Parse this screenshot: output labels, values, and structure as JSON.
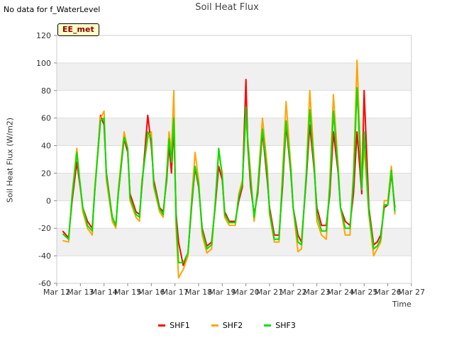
{
  "header": {
    "note": "No data for f_WaterLevel",
    "badge": "EE_met"
  },
  "chart_data": {
    "type": "line",
    "title": "Soil Heat Flux",
    "xlabel": "Time",
    "ylabel": "Soil Heat Flux (W/m2)",
    "ylim": [
      -60,
      120
    ],
    "xlim": [
      0,
      15
    ],
    "yticks": [
      -60,
      -40,
      -20,
      0,
      20,
      40,
      60,
      80,
      100,
      120
    ],
    "xticks": [
      "Mar 12",
      "Mar 13",
      "Mar 14",
      "Mar 15",
      "Mar 16",
      "Mar 17",
      "Mar 18",
      "Mar 19",
      "Mar 20",
      "Mar 21",
      "Mar 22",
      "Mar 23",
      "Mar 24",
      "Mar 25",
      "Mar 26",
      "Mar 27"
    ],
    "grid": true,
    "legend_position": "bottom-center",
    "x_units": "days since Mar 12",
    "series": [
      {
        "name": "SHF1",
        "color": "#ff0000",
        "x": [
          0.25,
          0.5,
          0.65,
          0.85,
          0.95,
          1.1,
          1.3,
          1.5,
          1.6,
          1.85,
          2.0,
          2.1,
          2.35,
          2.5,
          2.6,
          2.85,
          3.0,
          3.1,
          3.35,
          3.5,
          3.6,
          3.85,
          4.0,
          4.1,
          4.35,
          4.5,
          4.65,
          4.75,
          4.85,
          4.95,
          5.05,
          5.15,
          5.35,
          5.55,
          5.7,
          5.85,
          6.0,
          6.15,
          6.35,
          6.55,
          6.7,
          6.85,
          7.0,
          7.1,
          7.3,
          7.55,
          7.7,
          7.85,
          8.0,
          8.08,
          8.2,
          8.35,
          8.5,
          8.7,
          8.9,
          9.0,
          9.2,
          9.4,
          9.55,
          9.7,
          9.9,
          10.0,
          10.2,
          10.35,
          10.55,
          10.7,
          10.9,
          11.0,
          11.2,
          11.4,
          11.55,
          11.7,
          11.9,
          12.0,
          12.2,
          12.4,
          12.55,
          12.7,
          12.9,
          13.0,
          13.2,
          13.4,
          13.55,
          13.7,
          13.85,
          14.0,
          14.15,
          14.3
        ],
        "values": [
          -22,
          -27,
          0,
          28,
          15,
          -5,
          -15,
          -20,
          5,
          62,
          55,
          20,
          -12,
          -18,
          5,
          45,
          35,
          5,
          -8,
          -10,
          10,
          62,
          40,
          15,
          -5,
          -8,
          15,
          40,
          20,
          55,
          -10,
          -30,
          -47,
          -38,
          -5,
          24,
          10,
          -20,
          -33,
          -30,
          -5,
          25,
          15,
          -8,
          -15,
          -15,
          0,
          10,
          88,
          40,
          10,
          -10,
          5,
          50,
          15,
          -5,
          -25,
          -25,
          10,
          55,
          20,
          -5,
          -25,
          -30,
          15,
          55,
          20,
          -5,
          -18,
          -18,
          5,
          50,
          20,
          -5,
          -15,
          -18,
          5,
          50,
          5,
          80,
          -5,
          -32,
          -30,
          -25,
          -5,
          -3,
          20,
          -5
        ]
      },
      {
        "name": "SHF2",
        "color": "#ffa500",
        "x": [
          0.25,
          0.5,
          0.65,
          0.85,
          0.95,
          1.1,
          1.3,
          1.5,
          1.6,
          1.85,
          2.0,
          2.1,
          2.35,
          2.5,
          2.6,
          2.85,
          3.0,
          3.1,
          3.35,
          3.5,
          3.6,
          3.85,
          4.0,
          4.1,
          4.35,
          4.5,
          4.65,
          4.75,
          4.85,
          4.95,
          5.05,
          5.15,
          5.35,
          5.55,
          5.7,
          5.85,
          6.0,
          6.15,
          6.35,
          6.55,
          6.7,
          6.85,
          7.0,
          7.1,
          7.3,
          7.55,
          7.7,
          7.85,
          8.0,
          8.08,
          8.2,
          8.35,
          8.5,
          8.7,
          8.9,
          9.0,
          9.2,
          9.4,
          9.55,
          9.7,
          9.9,
          10.0,
          10.2,
          10.35,
          10.55,
          10.7,
          10.9,
          11.0,
          11.2,
          11.4,
          11.55,
          11.7,
          11.9,
          12.0,
          12.2,
          12.4,
          12.55,
          12.7,
          12.9,
          13.0,
          13.2,
          13.4,
          13.55,
          13.7,
          13.85,
          14.0,
          14.15,
          14.3
        ],
        "values": [
          -29,
          -30,
          5,
          38,
          18,
          -8,
          -20,
          -25,
          8,
          60,
          65,
          15,
          -15,
          -20,
          8,
          50,
          38,
          0,
          -12,
          -15,
          15,
          45,
          50,
          10,
          -8,
          -12,
          20,
          50,
          35,
          80,
          -20,
          -56,
          -50,
          -40,
          0,
          35,
          15,
          -25,
          -38,
          -35,
          -2,
          35,
          20,
          -12,
          -18,
          -18,
          5,
          15,
          60,
          45,
          20,
          -15,
          10,
          60,
          25,
          -10,
          -30,
          -30,
          20,
          72,
          25,
          -5,
          -37,
          -35,
          20,
          80,
          25,
          -15,
          -25,
          -28,
          15,
          77,
          25,
          -5,
          -25,
          -25,
          20,
          102,
          10,
          40,
          -10,
          -40,
          -35,
          -30,
          0,
          0,
          25,
          -10
        ]
      },
      {
        "name": "SHF3",
        "color": "#00e000",
        "x": [
          0.25,
          0.5,
          0.65,
          0.85,
          0.95,
          1.1,
          1.3,
          1.5,
          1.6,
          1.85,
          2.0,
          2.1,
          2.35,
          2.5,
          2.6,
          2.85,
          3.0,
          3.1,
          3.35,
          3.5,
          3.6,
          3.85,
          4.0,
          4.1,
          4.35,
          4.5,
          4.65,
          4.75,
          4.85,
          4.95,
          5.05,
          5.15,
          5.35,
          5.55,
          5.7,
          5.85,
          6.0,
          6.15,
          6.35,
          6.55,
          6.7,
          6.85,
          7.0,
          7.1,
          7.3,
          7.55,
          7.7,
          7.85,
          8.0,
          8.08,
          8.2,
          8.35,
          8.5,
          8.7,
          8.9,
          9.0,
          9.2,
          9.4,
          9.55,
          9.7,
          9.9,
          10.0,
          10.2,
          10.35,
          10.55,
          10.7,
          10.9,
          11.0,
          11.2,
          11.4,
          11.55,
          11.7,
          11.9,
          12.0,
          12.2,
          12.4,
          12.55,
          12.7,
          12.9,
          13.0,
          13.2,
          13.4,
          13.55,
          13.7,
          13.85,
          14.0,
          14.15,
          14.3
        ],
        "values": [
          -24,
          -28,
          3,
          35,
          18,
          -5,
          -18,
          -22,
          5,
          58,
          60,
          18,
          -12,
          -18,
          5,
          46,
          38,
          2,
          -10,
          -12,
          12,
          50,
          45,
          12,
          -6,
          -10,
          18,
          45,
          28,
          60,
          -15,
          -45,
          -45,
          -38,
          -3,
          25,
          12,
          -22,
          -35,
          -32,
          -3,
          38,
          18,
          -10,
          -16,
          -16,
          3,
          12,
          68,
          42,
          15,
          -12,
          8,
          52,
          20,
          -8,
          -28,
          -28,
          15,
          58,
          22,
          -5,
          -30,
          -32,
          18,
          66,
          22,
          -10,
          -22,
          -22,
          10,
          65,
          22,
          -5,
          -20,
          -20,
          15,
          82,
          8,
          50,
          -8,
          -35,
          -33,
          -28,
          -3,
          -3,
          22,
          -8
        ]
      }
    ]
  }
}
